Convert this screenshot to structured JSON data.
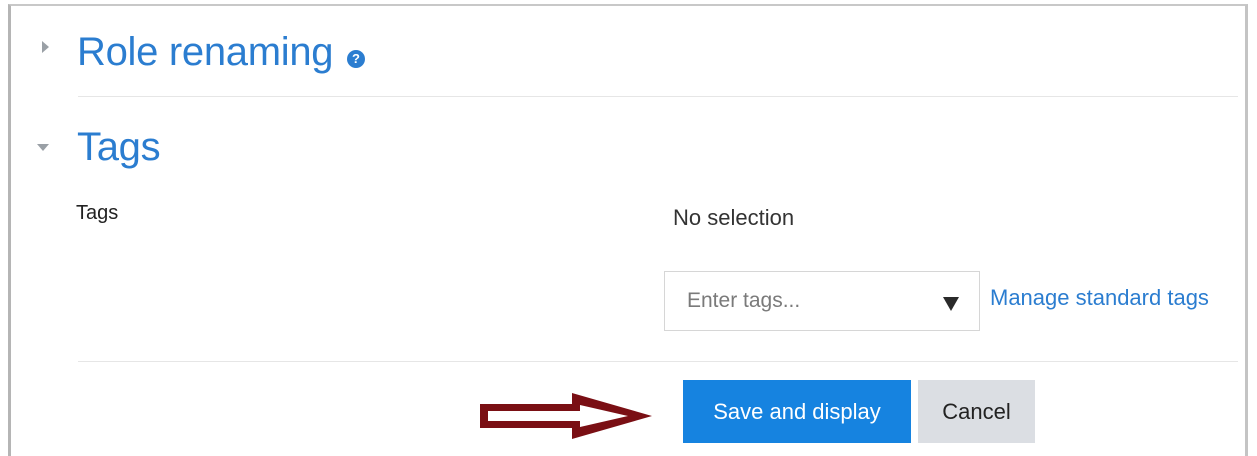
{
  "sections": {
    "role_renaming": {
      "title": "Role renaming",
      "help_icon": "question-circle-icon"
    },
    "tags": {
      "title": "Tags"
    }
  },
  "tags_field": {
    "label": "Tags",
    "selection_text": "No selection",
    "input_placeholder": "Enter tags...",
    "manage_link": "Manage standard tags"
  },
  "buttons": {
    "save_display": "Save and display",
    "cancel": "Cancel"
  },
  "colors": {
    "accent": "#2b7dd0",
    "primary_button": "#1683e0",
    "secondary_button": "#dbdee3",
    "annotation_arrow": "#7a0f14"
  }
}
